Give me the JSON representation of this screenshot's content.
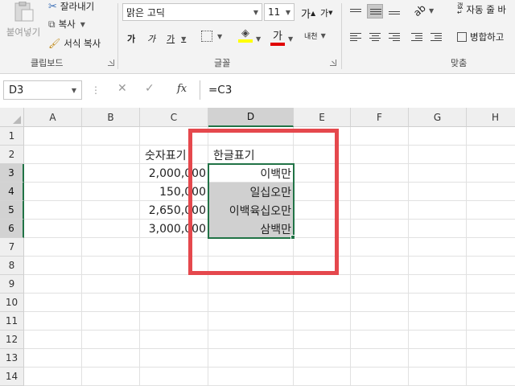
{
  "ribbon": {
    "paste_label": "붙여넣기",
    "cut_label": "잘라내기",
    "copy_label": "복사",
    "format_painter_label": "서식 복사",
    "clipboard_group": "클립보드",
    "font_name": "맑은 고딕",
    "font_size": "11",
    "grow_font": "가",
    "shrink_font": "가",
    "bold": "가",
    "italic": "가",
    "underline": "가",
    "font_color_glyph": "가",
    "phonetic_label": "내천",
    "font_group": "글꼴",
    "wrap_text_label": "자동 줄 바",
    "merge_label": "병합하고",
    "alignment_group": "맞춤"
  },
  "formula_bar": {
    "name_box": "D3",
    "formula": "=C3",
    "fx": "fx"
  },
  "columns": [
    "A",
    "B",
    "C",
    "D",
    "E",
    "F",
    "G",
    "H"
  ],
  "rows": [
    "1",
    "2",
    "3",
    "4",
    "5",
    "6",
    "7",
    "8",
    "9",
    "10",
    "11",
    "12",
    "13",
    "14"
  ],
  "cells": {
    "C2": "숫자표기",
    "D2": "한글표기",
    "C3": "2,000,000",
    "C4": "150,000",
    "C5": "2,650,000",
    "C6": "3,000,000",
    "D3": "이백만",
    "D4": "일십오만",
    "D5": "이백육십오만",
    "D6": "삼백만"
  },
  "selection": "D3:D6",
  "colors": {
    "accent": "#217346",
    "highlight": "#e5484d",
    "selected_fill": "#d0d0d0",
    "font_color_bar": "#e00000",
    "fill_color_bar": "#ffff00"
  }
}
